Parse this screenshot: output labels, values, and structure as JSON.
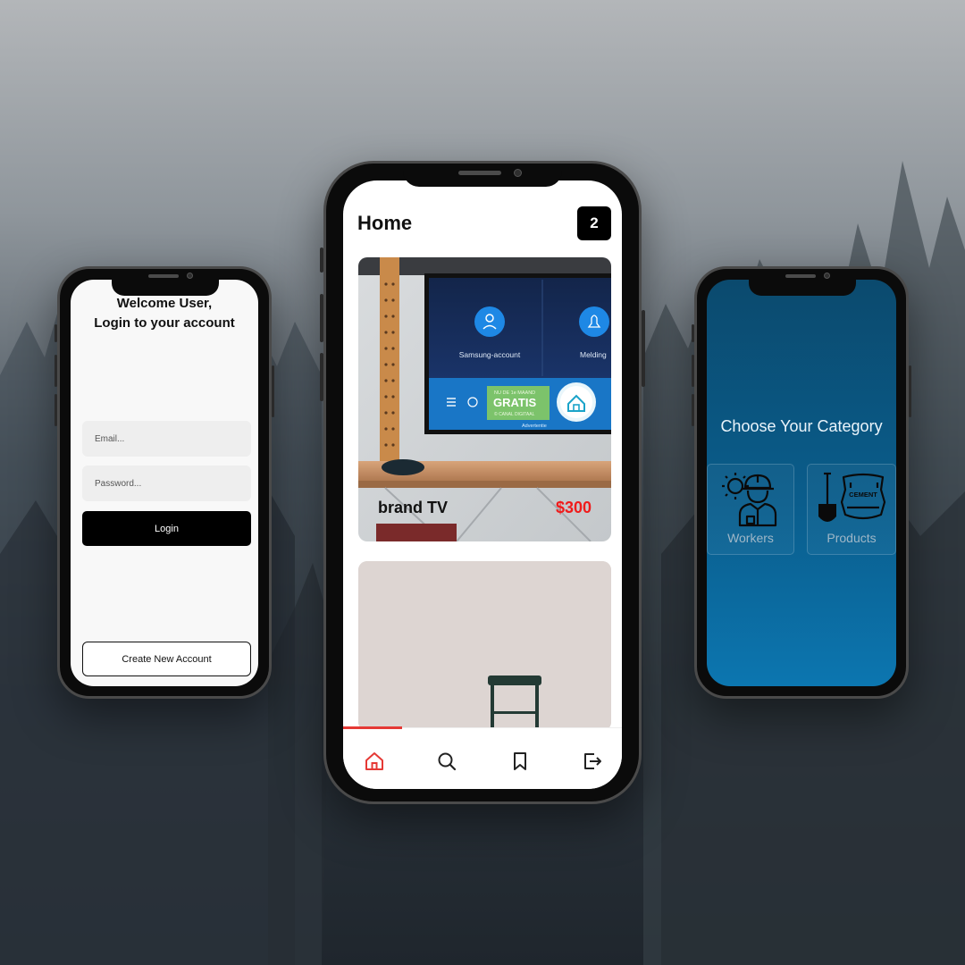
{
  "login_screen": {
    "title_line1": "Welcome User,",
    "title_line2": "Login to your account",
    "email_placeholder": "Email...",
    "password_placeholder": "Password...",
    "login_button": "Login",
    "create_account_button": "Create New Account"
  },
  "home_screen": {
    "title": "Home",
    "cart_count": "2",
    "products": [
      {
        "name": "brand TV",
        "price": "$300",
        "tv_screen": {
          "tile1_label": "Samsung-account",
          "tile2_label": "Melding",
          "banner_line1": "NU DE 1e MAAND",
          "banner_line2": "GRATIS",
          "banner_line3": "© CANAL DIGITAAL",
          "ad_label": "Advertentie"
        }
      },
      {}
    ],
    "tabbar": {
      "items": [
        "home-icon",
        "search-icon",
        "bookmark-icon",
        "logout-icon"
      ],
      "active_index": 0,
      "active_color": "#e53935"
    }
  },
  "category_screen": {
    "title": "Choose Your Category",
    "categories": [
      {
        "label": "Workers",
        "icon": "worker-icon",
        "icon_text": ""
      },
      {
        "label": "Products",
        "icon": "cement-bag-shovel-icon",
        "icon_text": "CEMENT"
      }
    ]
  },
  "colors": {
    "price": "#f01b1b",
    "category_bg_top": "#0b4a6e",
    "category_bg_bottom": "#0c76b0"
  }
}
